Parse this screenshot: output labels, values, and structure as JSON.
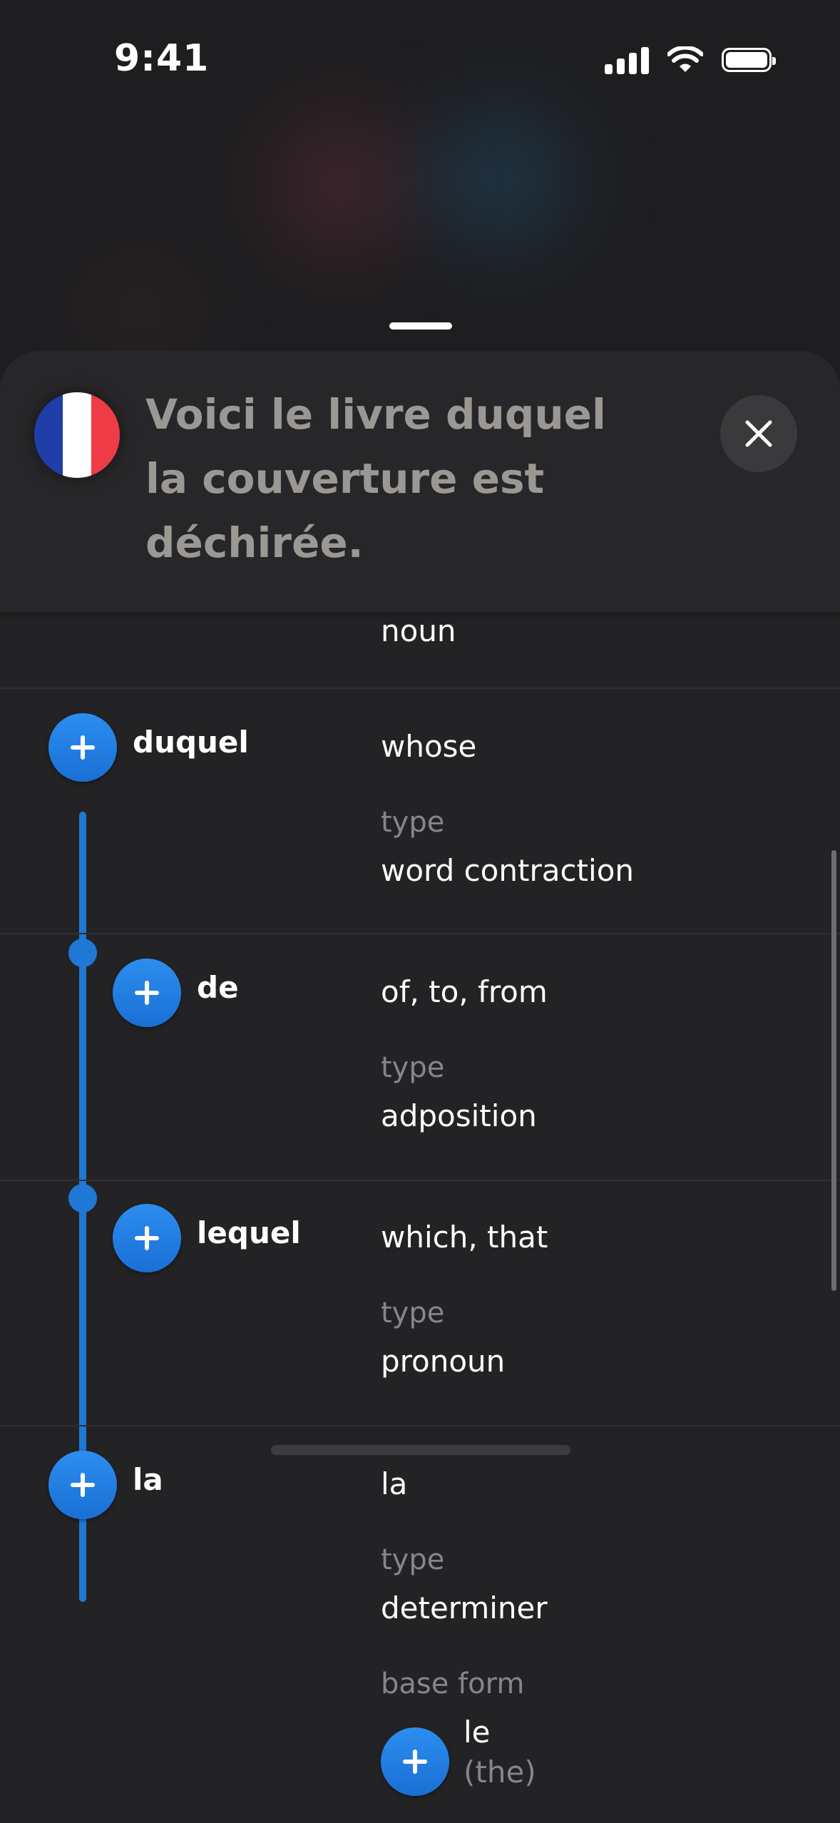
{
  "status": {
    "time": "9:41"
  },
  "header": {
    "sentence": "Voici le livre duquel la couverture est déchirée.",
    "close_icon": "close-icon"
  },
  "flag": {
    "colors": [
      "#1f3ea8",
      "#ffffff",
      "#ef3b45"
    ]
  },
  "previous_meaning": "noun",
  "entries": [
    {
      "word": "duquel",
      "meaning": "whose",
      "type_label": "type",
      "type_value": "word contraction"
    },
    {
      "word": "de",
      "meaning": "of, to, from",
      "type_label": "type",
      "type_value": "adposition"
    },
    {
      "word": "lequel",
      "meaning": "which, that",
      "type_label": "type",
      "type_value": "pronoun"
    },
    {
      "word": "la",
      "meaning": "la",
      "type_label": "type",
      "type_value": "determiner",
      "base_label": "base form",
      "base_word": "le",
      "base_meaning": "(the)"
    }
  ],
  "colors": {
    "accent": "#1f78d4",
    "background": "#1e1e20",
    "sheet": "#232325",
    "muted_text": "#86868a"
  }
}
